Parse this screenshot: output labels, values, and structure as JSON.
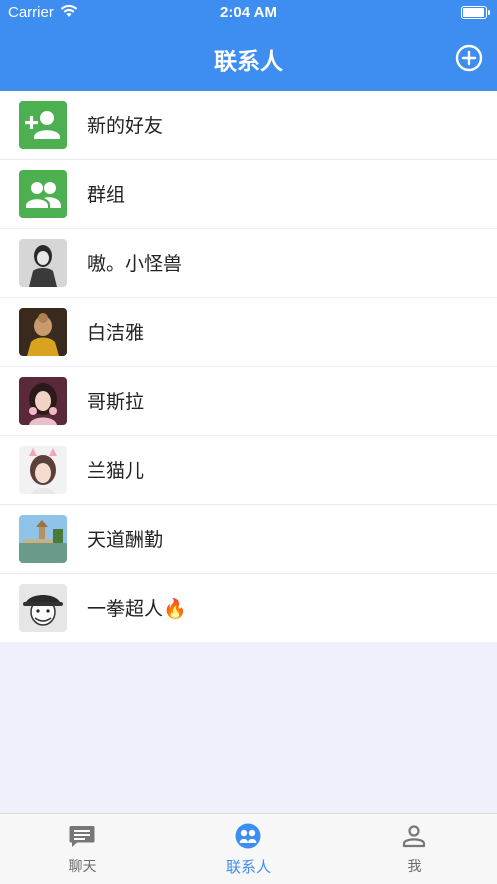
{
  "status_bar": {
    "carrier": "Carrier",
    "time": "2:04 AM",
    "battery_level": 0.95
  },
  "header": {
    "title": "联系人",
    "add_icon": "plus-circle-icon"
  },
  "contacts": [
    {
      "name": "新的好友",
      "avatar": "add-person-icon"
    },
    {
      "name": "群组",
      "avatar": "group-icon"
    },
    {
      "name": "嗷。小怪兽",
      "avatar": "photo"
    },
    {
      "name": "白洁雅",
      "avatar": "photo"
    },
    {
      "name": "哥斯拉",
      "avatar": "photo"
    },
    {
      "name": "兰猫儿",
      "avatar": "photo"
    },
    {
      "name": "天道酬勤",
      "avatar": "photo"
    },
    {
      "name": "一拳超人🔥",
      "avatar": "photo"
    }
  ],
  "tabs": [
    {
      "label": "聊天",
      "icon": "chat-icon",
      "active": false
    },
    {
      "label": "联系人",
      "icon": "contacts-icon",
      "active": true
    },
    {
      "label": "我",
      "icon": "person-icon",
      "active": false
    }
  ],
  "colors": {
    "brand": "#3d8ef0",
    "green": "#4caf50",
    "background": "#eef0fb"
  }
}
